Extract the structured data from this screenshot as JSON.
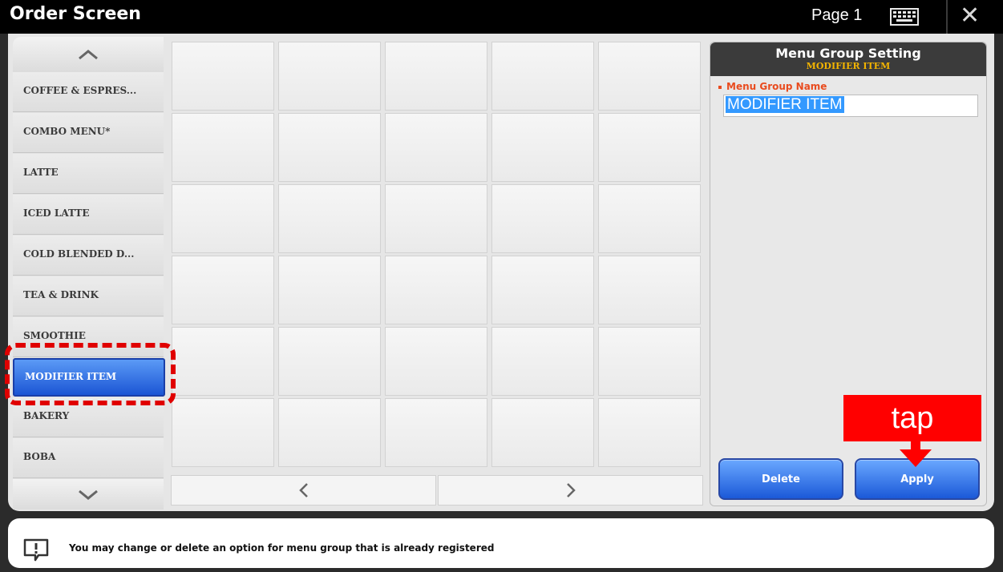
{
  "window": {
    "title": "Order Screen",
    "page_label": "Page 1"
  },
  "sidebar": {
    "items": [
      {
        "label": "COFFEE & ESPRES..."
      },
      {
        "label": "COMBO MENU*"
      },
      {
        "label": "LATTE"
      },
      {
        "label": "ICED LATTE"
      },
      {
        "label": "COLD BLENDED D..."
      },
      {
        "label": "TEA & DRINK"
      },
      {
        "label": "SMOOTHIE"
      },
      {
        "label": "MODIFIER ITEM",
        "selected": true
      },
      {
        "label": "BAKERY"
      },
      {
        "label": "BOBA"
      }
    ]
  },
  "menu_grid": {
    "rows": 6,
    "columns": 5
  },
  "settings": {
    "title": "Menu Group Setting",
    "subtitle": "MODIFIER ITEM",
    "field_label": "Menu Group Name",
    "field_value": "MODIFIER ITEM",
    "delete_label": "Delete",
    "apply_label": "Apply"
  },
  "annotation": {
    "tap_label": "tap",
    "color": "#ff0000"
  },
  "footer": {
    "message": "You may change or delete an option for menu group that is already registered"
  },
  "colors": {
    "accent_blue": "#1b59d8",
    "label_orange": "#e94b1e",
    "subtitle_gold": "#f3b400"
  },
  "icons": [
    "keyboard-icon",
    "close-icon",
    "chevron-up-icon",
    "chevron-down-icon",
    "chevron-left-icon",
    "chevron-right-icon",
    "info-icon",
    "down-arrow-icon"
  ]
}
